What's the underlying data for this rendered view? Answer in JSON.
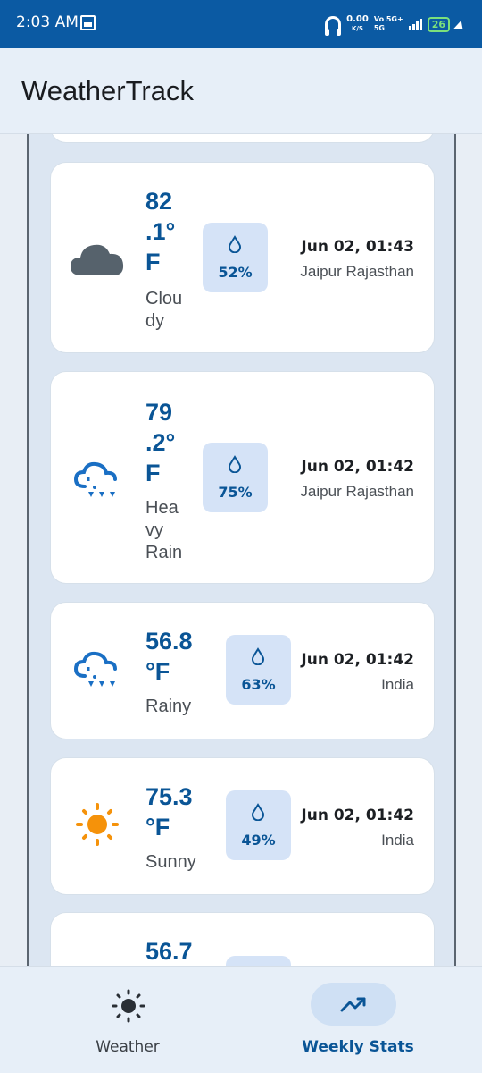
{
  "status_bar": {
    "time": "2:03 AM",
    "speed_value": "0.00",
    "speed_unit": "K/S",
    "network_top": "Vo 5G+",
    "network_bottom": "5G",
    "battery": "26",
    "colors": {
      "background": "#0b5aa3",
      "battery": "#7be07b"
    }
  },
  "app_bar": {
    "title": "WeatherTrack"
  },
  "weather_entries": [
    {
      "icon": "cloudy-icon",
      "temp_lines": [
        "82",
        ".1°",
        "F"
      ],
      "condition_lines": [
        "Clou",
        "dy"
      ],
      "humidity": "52%",
      "datetime": "Jun 02, 01:43",
      "location": "Jaipur Rajasthan"
    },
    {
      "icon": "heavy-rain-icon",
      "temp_lines": [
        "79",
        ".2°",
        "F"
      ],
      "condition_lines": [
        "Hea",
        "vy",
        "Rain"
      ],
      "humidity": "75%",
      "datetime": "Jun 02, 01:42",
      "location": "Jaipur Rajasthan"
    },
    {
      "icon": "rain-icon",
      "temp_lines": [
        "56.8",
        "°F"
      ],
      "condition_lines": [
        "Rainy"
      ],
      "humidity": "63%",
      "datetime": "Jun 02, 01:42",
      "location": "India"
    },
    {
      "icon": "sun-icon",
      "temp_lines": [
        "75.3",
        "°F"
      ],
      "condition_lines": [
        "Sunny"
      ],
      "humidity": "49%",
      "datetime": "Jun 02, 01:42",
      "location": "India"
    },
    {
      "icon": "",
      "temp_lines": [
        "56.7"
      ],
      "condition_lines": [],
      "humidity": "",
      "datetime": "",
      "location": ""
    }
  ],
  "bottom_nav": {
    "items": [
      {
        "label": "Weather",
        "icon": "sun-outline-icon",
        "active": false
      },
      {
        "label": "Weekly Stats",
        "icon": "trending-up-icon",
        "active": true
      }
    ]
  },
  "colors": {
    "accent": "#0a5596",
    "humidity_bg": "#d5e3f7",
    "list_bg": "#dce6f2"
  }
}
